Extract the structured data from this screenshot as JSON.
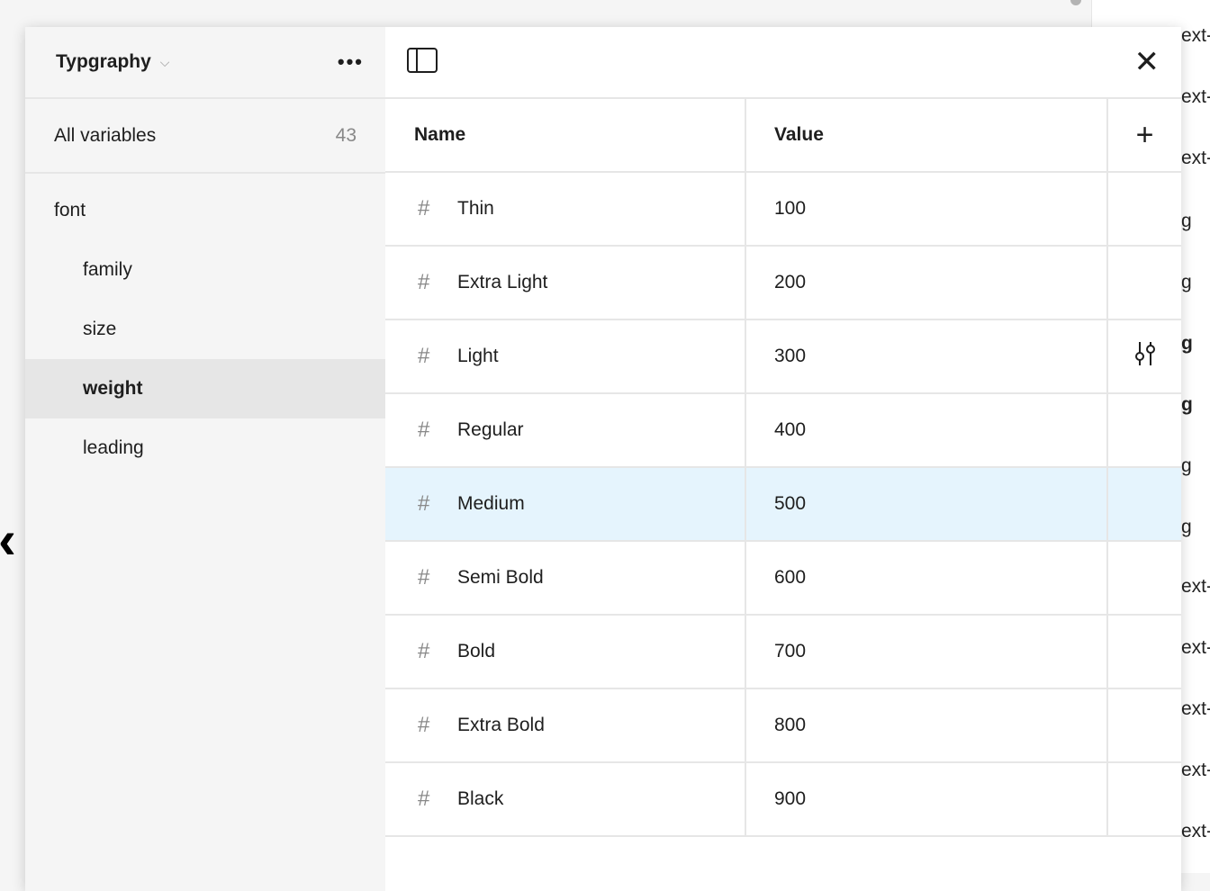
{
  "background": {
    "fragments": [
      "ext-",
      "ext-",
      "ext-",
      "g",
      "g",
      "g",
      "g",
      "g",
      "g",
      "ext-",
      "ext-",
      "ext-",
      "ext-",
      "ext-"
    ]
  },
  "sidebar": {
    "title": "Typgraphy",
    "all_variables": {
      "label": "All variables",
      "count": "43"
    },
    "groups": [
      {
        "label": "font",
        "level": 0
      },
      {
        "label": "family",
        "level": 1
      },
      {
        "label": "size",
        "level": 1
      },
      {
        "label": "weight",
        "level": 1,
        "selected": true
      },
      {
        "label": "leading",
        "level": 1
      }
    ]
  },
  "table": {
    "headers": {
      "name": "Name",
      "value": "Value"
    },
    "rows": [
      {
        "name": "Thin",
        "value": "100"
      },
      {
        "name": "Extra Light",
        "value": "200"
      },
      {
        "name": "Light",
        "value": "300"
      },
      {
        "name": "Regular",
        "value": "400"
      },
      {
        "name": "Medium",
        "value": "500"
      },
      {
        "name": "Semi Bold",
        "value": "600"
      },
      {
        "name": "Bold",
        "value": "700"
      },
      {
        "name": "Extra Bold",
        "value": "800"
      },
      {
        "name": "Black",
        "value": "900"
      }
    ],
    "highlighted_row": "Medium",
    "highlight_color": "#e5f4fd"
  }
}
